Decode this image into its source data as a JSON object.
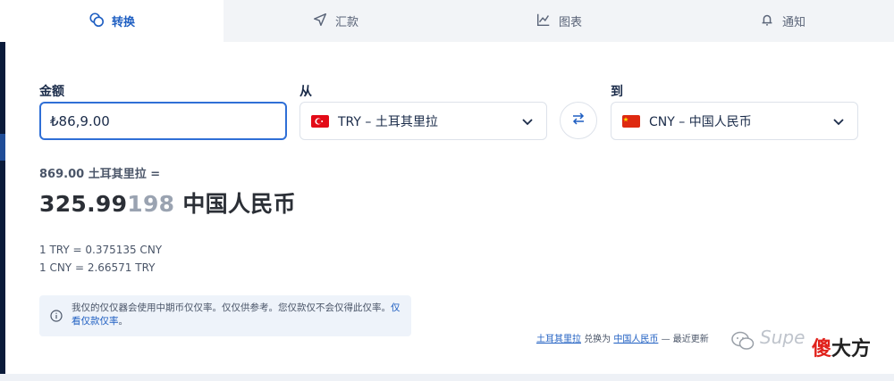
{
  "tabs": [
    {
      "label": "转换",
      "icon": "coins-icon",
      "active": true
    },
    {
      "label": "汇款",
      "icon": "send-icon",
      "active": false
    },
    {
      "label": "图表",
      "icon": "chart-icon",
      "active": false
    },
    {
      "label": "通知",
      "icon": "bell-icon",
      "active": false
    }
  ],
  "form": {
    "amount_label": "金额",
    "amount_value": "₺86,9.00",
    "from_label": "从",
    "from_currency": "TRY – 土耳其里拉",
    "to_label": "到",
    "to_currency": "CNY – 中国人民币"
  },
  "result": {
    "from_line": "869.00 土耳其里拉 =",
    "value_main": "325.99",
    "value_dim": "198",
    "currency": " 中国人民币"
  },
  "rates": {
    "line1": "1 TRY = 0.375135 CNY",
    "line2": "1 CNY = 2.66571 TRY"
  },
  "info": {
    "text": "我仅的仅仅器会使用中期币仅仅率。仅仅供参考。您仅款仅不会仅得此仅率。",
    "link1": "仅",
    "link2": "看仅款仅率",
    "end": "。"
  },
  "footer": {
    "from_link": "土耳其里拉",
    "mid": "兑换为",
    "to_link": "中国人民币",
    "tail": "— 最近更新"
  },
  "watermark": {
    "partial": "Supe",
    "red_char": "傻",
    "rest": "大方"
  },
  "colors": {
    "accent": "#1f5fc2",
    "input_border": "#2f6fd6",
    "text_dark": "#1a2b49",
    "dim_digits": "#9aa3b1"
  }
}
